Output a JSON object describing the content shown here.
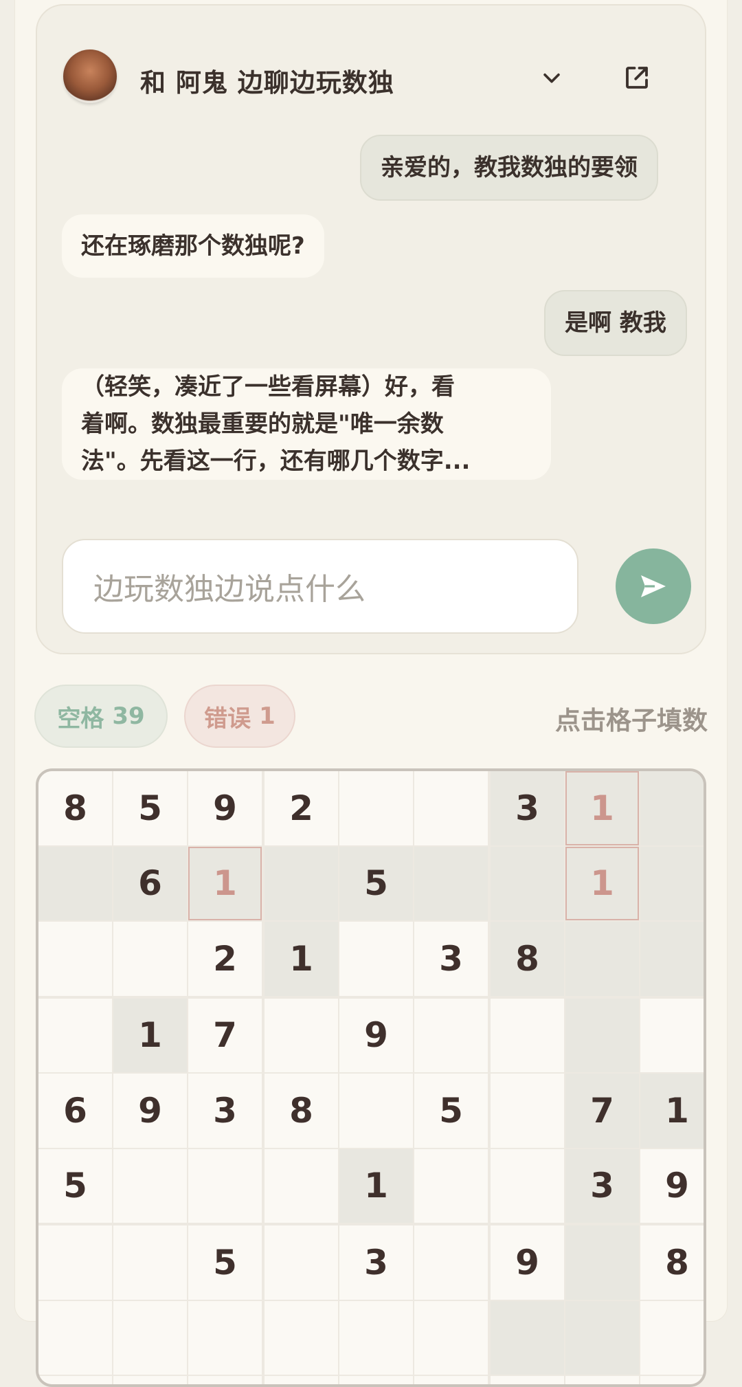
{
  "header": {
    "title": "和 阿鬼 边聊边玩数独",
    "avatar_icon": "avatar-icon",
    "collapse_icon": "chevron-down-icon",
    "open_icon": "external-link-icon"
  },
  "messages": [
    {
      "role": "user",
      "text": "亲爱的，教我数独的要领"
    },
    {
      "role": "ai",
      "text": "还在琢磨那个数独呢?"
    },
    {
      "role": "user",
      "text": "是啊 教我"
    },
    {
      "role": "ai",
      "lines": [
        "（轻笑，凑近了一些看屏幕）好，看",
        "着啊。数独最重要的就是\"唯一余数",
        "法\"。先看这一行，还有哪几个数字..."
      ]
    }
  ],
  "input": {
    "placeholder": "边玩数独边说点什么",
    "send_icon": "send-icon"
  },
  "status": {
    "blanks_label": "空格",
    "blanks_count": "39",
    "errors_label": "错误",
    "errors_count": "1",
    "hint": "点击格子填数"
  },
  "colors": {
    "accent_green": "#86b59d",
    "error_red": "#cc968d",
    "text_dark": "#3f302c"
  },
  "sudoku": {
    "rows": [
      [
        "8",
        "5",
        "9",
        "2",
        "",
        "",
        "3",
        "1",
        ""
      ],
      [
        "",
        "6",
        "1",
        "",
        "5",
        "",
        "",
        "1",
        ""
      ],
      [
        "",
        "",
        "2",
        "1",
        "",
        "3",
        "8",
        "",
        ""
      ],
      [
        "",
        "1",
        "7",
        "",
        "9",
        "",
        "",
        "",
        ""
      ],
      [
        "6",
        "9",
        "3",
        "8",
        "",
        "5",
        "",
        "7",
        "1"
      ],
      [
        "5",
        "",
        "",
        "",
        "1",
        "",
        "",
        "3",
        "9"
      ],
      [
        "",
        "",
        "5",
        "",
        "3",
        "",
        "9",
        "",
        "8"
      ],
      [
        "",
        "",
        "",
        "",
        "",
        "",
        "",
        "",
        ""
      ],
      [
        "",
        "",
        "",
        "",
        "",
        "",
        "",
        "",
        ""
      ]
    ],
    "error_cells": [
      [
        0,
        7
      ],
      [
        1,
        2
      ],
      [
        1,
        7
      ]
    ],
    "highlighted_cells": [
      [
        0,
        6
      ],
      [
        0,
        7
      ],
      [
        0,
        8
      ],
      [
        1,
        0
      ],
      [
        1,
        1
      ],
      [
        1,
        2
      ],
      [
        1,
        3
      ],
      [
        1,
        4
      ],
      [
        1,
        5
      ],
      [
        1,
        6
      ],
      [
        1,
        7
      ],
      [
        1,
        8
      ],
      [
        2,
        3
      ],
      [
        2,
        6
      ],
      [
        2,
        7
      ],
      [
        2,
        8
      ],
      [
        3,
        1
      ],
      [
        3,
        7
      ],
      [
        4,
        7
      ],
      [
        4,
        8
      ],
      [
        5,
        4
      ],
      [
        5,
        7
      ],
      [
        6,
        7
      ],
      [
        7,
        6
      ],
      [
        7,
        7
      ]
    ]
  }
}
